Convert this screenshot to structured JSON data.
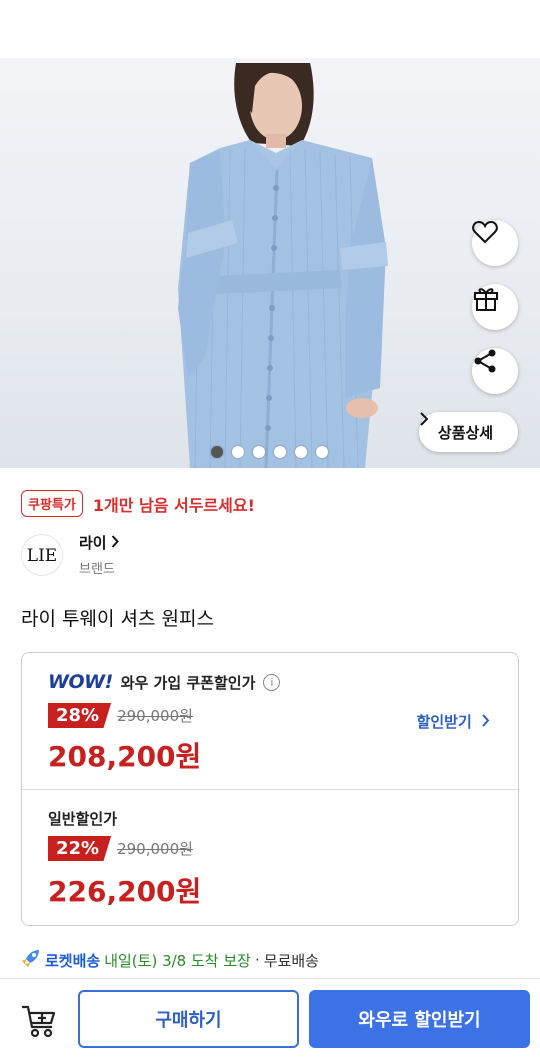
{
  "product_image": {
    "carousel": {
      "count": 6,
      "active_index": 0
    },
    "actions": {
      "wishlist_icon": "heart-icon",
      "gift_icon": "gift-icon",
      "share_icon": "share-icon",
      "detail_label": "상품상세"
    }
  },
  "promo": {
    "badge": "쿠팡특가",
    "text": "1개만 남음 서두르세요!"
  },
  "brand": {
    "logo_text": "LIE",
    "name": "라이",
    "sub": "브랜드"
  },
  "product": {
    "title": "라이 투웨이 셔츠 원피스"
  },
  "pricing": {
    "wow": {
      "logo": "WOW!",
      "label": "와우 가입 쿠폰할인가",
      "rate": "28%",
      "original": "290,000원",
      "final": "208,200원",
      "coupon_link": "할인받기"
    },
    "normal": {
      "label": "일반할인가",
      "rate": "22%",
      "original": "290,000원",
      "final": "226,200원"
    }
  },
  "delivery": {
    "rocket_label": "로켓배송",
    "date_text": "내일(토) 3/8 도착 보장",
    "separator": "·",
    "shipping": "무료배송"
  },
  "bottom_bar": {
    "buy_label": "구매하기",
    "wow_label": "와우로 할인받기"
  },
  "colors": {
    "accent_red": "#c8201f",
    "accent_blue": "#3d71e6",
    "rocket_blue": "#1b5dd8"
  }
}
